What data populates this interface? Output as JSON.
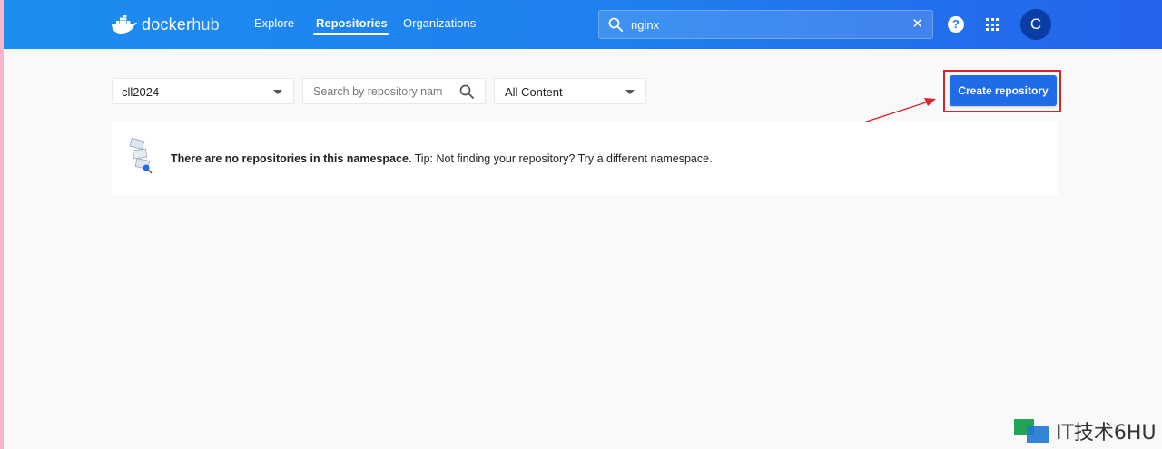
{
  "header": {
    "logo_docker": "docker",
    "logo_hub": "hub",
    "nav": [
      {
        "label": "Explore"
      },
      {
        "label": "Repositories",
        "active": true
      },
      {
        "label": "Organizations"
      }
    ],
    "search_value": "nginx",
    "clear_symbol": "✕",
    "help_symbol": "?",
    "avatar_letter": "C"
  },
  "toolbar": {
    "namespace_value": "cll2024",
    "search_placeholder": "Search by repository nam",
    "content_filter_value": "All Content",
    "create_button_label": "Create repository"
  },
  "empty_state": {
    "bold_text": "There are no repositories in this namespace.",
    "tip_text": " Tip: Not finding your repository? Try a different namespace."
  },
  "watermark": {
    "text": "IT技术6HU"
  },
  "colors": {
    "header_blue": "#1f7fef",
    "primary_button": "#1f6be8",
    "annotation_red": "#d9252a"
  }
}
